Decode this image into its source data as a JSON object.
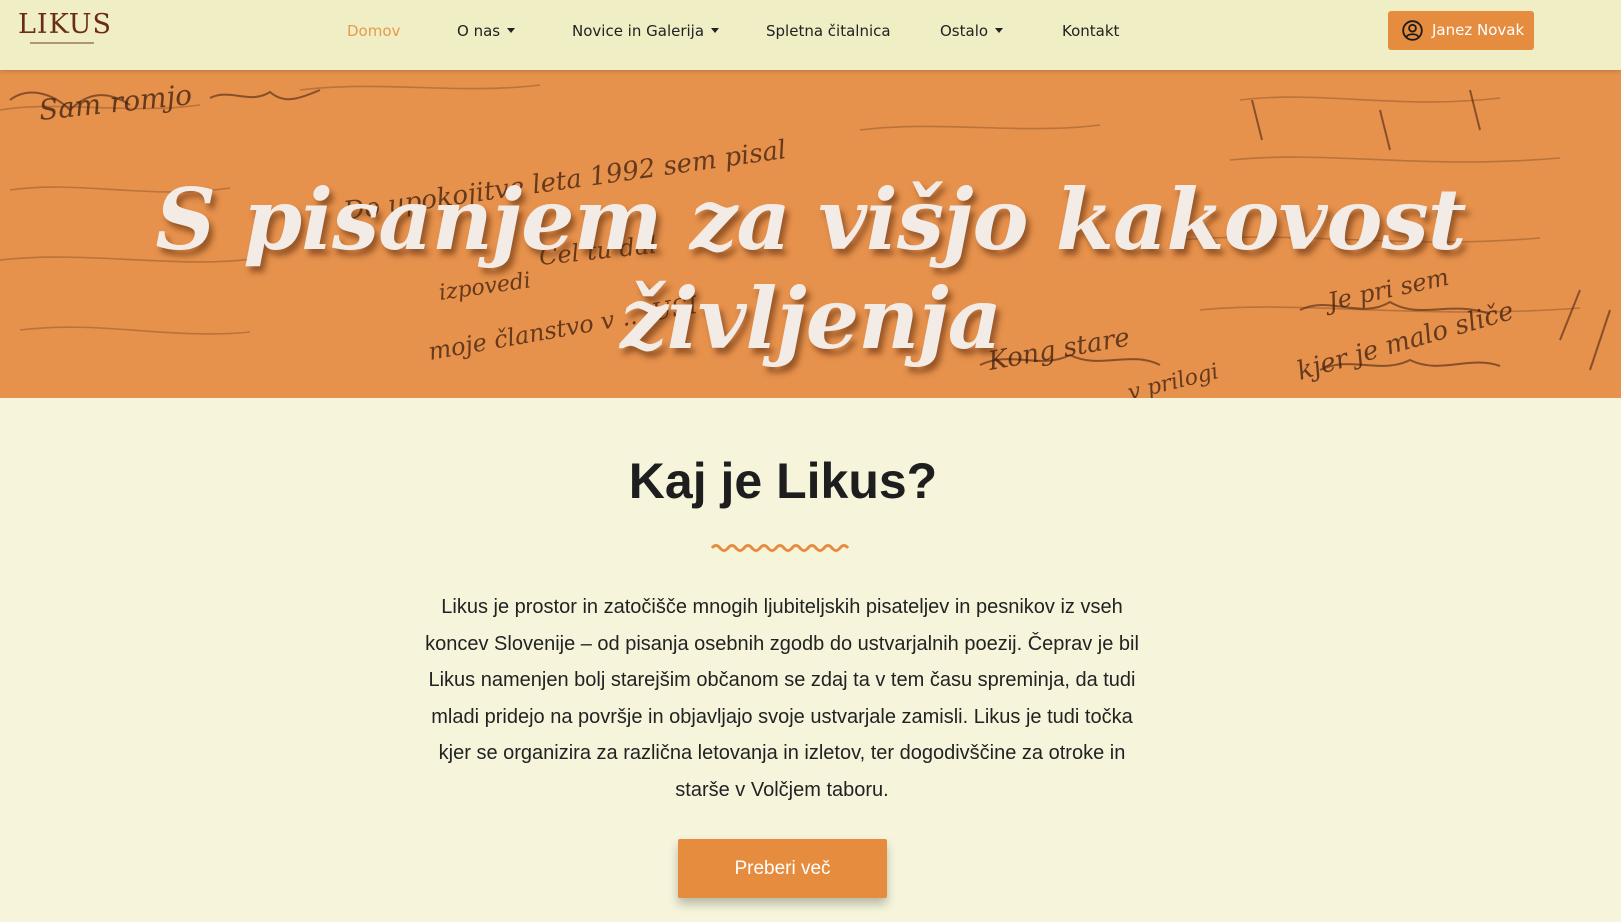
{
  "brand": {
    "logo_text": "LIKUS"
  },
  "nav": {
    "items": [
      {
        "label": "Domov",
        "active": true,
        "dropdown": false
      },
      {
        "label": "O nas",
        "active": false,
        "dropdown": true
      },
      {
        "label": "Novice in Galerija",
        "active": false,
        "dropdown": true
      },
      {
        "label": "Spletna čitalnica",
        "active": false,
        "dropdown": false
      },
      {
        "label": "Ostalo",
        "active": false,
        "dropdown": true
      },
      {
        "label": "Kontakt",
        "active": false,
        "dropdown": false
      }
    ],
    "user_button": {
      "label": "Janez Novak",
      "icon": "user-circle-icon"
    }
  },
  "hero": {
    "title": "S pisanjem za višjo kakovost življenja",
    "handwriting": [
      "Do upokojitve leta 1992 sem pisal",
      "Cel tu dal",
      "izpovedi",
      "moje članstvo v ... USI",
      "Sam romjo",
      "Kong stare",
      "v prilogi",
      "kjer je malo sliče",
      "Je pri sem"
    ]
  },
  "main": {
    "title": "Kaj je Likus?",
    "paragraph_lines": [
      "Likus je prostor in zatočišče mnogih ljubiteljskih pisateljev in pesnikov iz vseh",
      "koncev Slovenije – od pisanja osebnih zgodb do ustvarjalnih poezij. Čeprav je bil",
      "Likus namenjen bolj starejšim občanom se zdaj ta v tem času spreminja, da tudi",
      "mladi pridejo na površje in objavljajo svoje ustvarjale zamisli. Likus je tudi točka",
      "kjer se organizira za različna letovanja in izletov, ter dogodivščine za otroke in",
      "starše v Volčjem taboru."
    ],
    "button_label": "Preberi več"
  },
  "colors": {
    "accent": "#e58c3f",
    "navbar_bg": "#efeec4",
    "page_bg": "#f6f5dc",
    "hero_bg": "#e6914c",
    "brand_text": "#6b2d12"
  }
}
